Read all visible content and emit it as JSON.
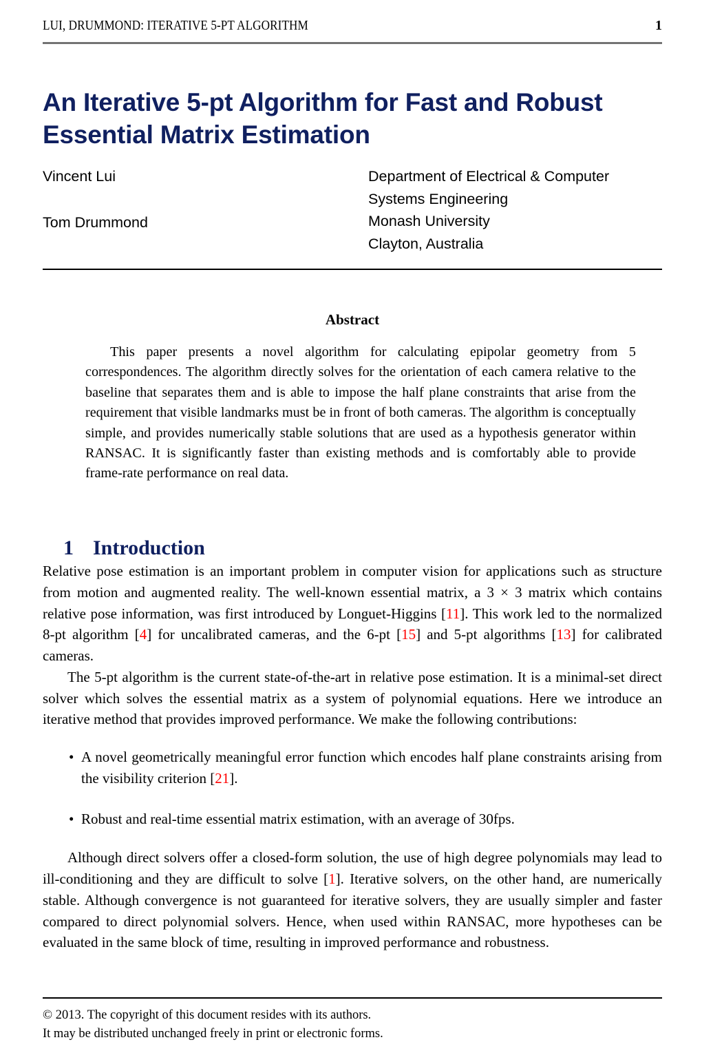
{
  "running_header": {
    "title": "LUI, DRUMMOND: ITERATIVE 5-PT ALGORITHM",
    "page_number": "1"
  },
  "title": "An Iterative 5-pt Algorithm for Fast and Robust Essential Matrix Estimation",
  "authors": {
    "name_1": "Vincent Lui",
    "name_2": "Tom Drummond",
    "affiliation_line_1": "Department of Electrical & Computer",
    "affiliation_line_2": "Systems Engineering",
    "affiliation_line_3": "Monash University",
    "affiliation_line_4": "Clayton, Australia"
  },
  "abstract": {
    "heading": "Abstract",
    "body": "This paper presents a novel algorithm for calculating epipolar geometry from 5 correspondences. The algorithm directly solves for the orientation of each camera relative to the baseline that separates them and is able to impose the half plane constraints that arise from the requirement that visible landmarks must be in front of both cameras. The algorithm is conceptually simple, and provides numerically stable solutions that are used as a hypothesis generator within RANSAC. It is significantly faster than existing methods and is comfortably able to provide frame-rate performance on real data."
  },
  "section": {
    "number": "1",
    "heading": "Introduction"
  },
  "paragraphs": {
    "p1_part1": "Relative pose estimation is an important problem in computer vision for applications such as structure from motion and augmented reality. The well-known essential matrix, a 3 × 3 matrix which contains relative pose information, was first introduced by Longuet-Higgins  [",
    "p1_cite_1": "11",
    "p1_part2": "]. This work led to the normalized 8-pt algorithm [",
    "p1_cite_2": "4",
    "p1_part3": "] for uncalibrated cameras, and the 6-pt [",
    "p1_cite_3": "15",
    "p1_part4": "] and 5-pt algorithms [",
    "p1_cite_4": "13",
    "p1_part5": "] for calibrated cameras.",
    "p2": "The 5-pt algorithm is the current state-of-the-art in relative pose estimation.  It is a minimal-set direct solver which solves the essential matrix as a system of polynomial equations. Here we introduce an iterative method that provides improved performance. We make the following contributions:",
    "p3_part1": "Although direct solvers offer a closed-form solution, the use of high degree polynomials may lead to ill-conditioning and they are difficult to solve [",
    "p3_cite_1": "1",
    "p3_part2": "]. Iterative solvers, on the other hand, are numerically stable.  Although convergence is not guaranteed for iterative solvers, they are usually simpler and faster compared to direct polynomial solvers. Hence, when used within RANSAC, more hypotheses can be evaluated in the same block of time, resulting in improved performance and robustness."
  },
  "bullets": {
    "marker": "•",
    "item_1_part1": "A novel geometrically meaningful error function which encodes half plane constraints arising from the visibility criterion [",
    "item_1_cite": "21",
    "item_1_part2": "].",
    "item_2": "Robust and real-time essential matrix estimation, with an average of 30fps."
  },
  "footer": {
    "copyright_symbol": "©",
    "line_1": " 2013. The copyright of this document resides with its authors.",
    "line_2": "It may be distributed unchanged freely in print or electronic forms."
  },
  "colors": {
    "title_navy": "#102060",
    "citation_red": "#ff0000",
    "header_rule_gray": "#737373",
    "rule_black": "#000000"
  }
}
